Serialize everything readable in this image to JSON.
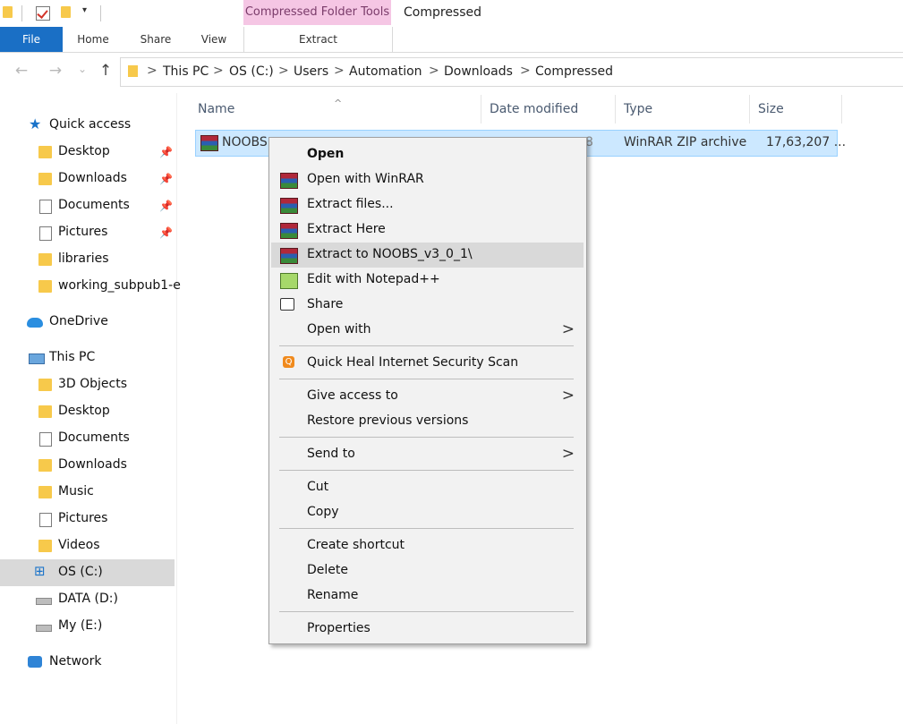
{
  "ribbon": {
    "contextual_label": "Compressed Folder Tools",
    "window_title": "Compressed",
    "tabs": {
      "file": "File",
      "home": "Home",
      "share": "Share",
      "view": "View",
      "extract": "Extract"
    }
  },
  "address": {
    "back_icon": "←",
    "forward_icon": "→",
    "recent_icon": "⌄",
    "up_icon": "↑",
    "separator": ">",
    "crumbs": [
      "This PC",
      "OS (C:)",
      "Users",
      "Automation",
      "Downloads",
      "Compressed"
    ]
  },
  "nav": {
    "pin_icon": "📌",
    "star_icon": "★",
    "items": [
      {
        "label": "Quick access"
      },
      {
        "label": "Desktop"
      },
      {
        "label": "Downloads"
      },
      {
        "label": "Documents"
      },
      {
        "label": "Pictures"
      },
      {
        "label": "libraries"
      },
      {
        "label": "working_subpub1-e"
      },
      {
        "label": "OneDrive"
      },
      {
        "label": "This PC"
      },
      {
        "label": "3D Objects"
      },
      {
        "label": "Desktop"
      },
      {
        "label": "Documents"
      },
      {
        "label": "Downloads"
      },
      {
        "label": "Music"
      },
      {
        "label": "Pictures"
      },
      {
        "label": "Videos"
      },
      {
        "label": "OS (C:)"
      },
      {
        "label": "DATA (D:)"
      },
      {
        "label": "My (E:)"
      },
      {
        "label": "Network"
      }
    ]
  },
  "columns": {
    "name": "Name",
    "date": "Date modified",
    "type": "Type",
    "size": "Size",
    "sort_icon": "^"
  },
  "file": {
    "name": "NOOBS",
    "date_fragment": "8",
    "type": "WinRAR ZIP archive",
    "size": "17,63,207 ..."
  },
  "menu": {
    "chevron_icon": ">",
    "quickheal_icon": "Q",
    "items": {
      "open": "Open",
      "open_winrar": "Open with WinRAR",
      "extract_files": "Extract files...",
      "extract_here": "Extract Here",
      "extract_to": "Extract to NOOBS_v3_0_1\\",
      "edit_npp": "Edit with Notepad++",
      "share": "Share",
      "open_with": "Open with",
      "quickheal": "Quick Heal Internet Security Scan",
      "give_access": "Give access to",
      "restore": "Restore previous versions",
      "send_to": "Send to",
      "cut": "Cut",
      "copy": "Copy",
      "create_shortcut": "Create shortcut",
      "delete": "Delete",
      "rename": "Rename",
      "properties": "Properties"
    }
  }
}
